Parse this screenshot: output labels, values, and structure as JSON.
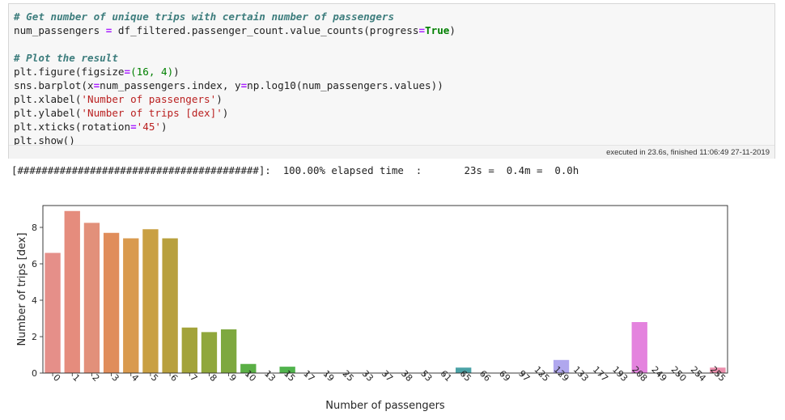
{
  "code_cell": {
    "lines": [
      [
        {
          "t": "# Get number of unique trips with certain number of passengers",
          "c": "cm"
        }
      ],
      [
        {
          "t": "num_passengers "
        },
        {
          "t": "=",
          "c": "op"
        },
        {
          "t": " df_filtered.passenger_count.value_counts(progress"
        },
        {
          "t": "=",
          "c": "op"
        },
        {
          "t": "True",
          "c": "kw"
        },
        {
          "t": ")"
        }
      ],
      [
        {
          "t": ""
        }
      ],
      [
        {
          "t": "# Plot the result",
          "c": "cm"
        }
      ],
      [
        {
          "t": "plt.figure(figsize"
        },
        {
          "t": "=",
          "c": "op"
        },
        {
          "t": "(16, 4)",
          "c": "num"
        },
        {
          "t": ")"
        }
      ],
      [
        {
          "t": "sns.barplot(x"
        },
        {
          "t": "=",
          "c": "op"
        },
        {
          "t": "num_passengers.index, y"
        },
        {
          "t": "=",
          "c": "op"
        },
        {
          "t": "np.log10(num_passengers.values))"
        }
      ],
      [
        {
          "t": "plt.xlabel("
        },
        {
          "t": "'Number of passengers'",
          "c": "str"
        },
        {
          "t": ")"
        }
      ],
      [
        {
          "t": "plt.ylabel("
        },
        {
          "t": "'Number of trips [dex]'",
          "c": "str"
        },
        {
          "t": ")"
        }
      ],
      [
        {
          "t": "plt.xticks(rotation"
        },
        {
          "t": "=",
          "c": "op"
        },
        {
          "t": "'45'",
          "c": "str"
        },
        {
          "t": ")"
        }
      ],
      [
        {
          "t": "plt.show()"
        }
      ]
    ],
    "execution_info": "executed in 23.6s, finished 11:06:49 27-11-2019"
  },
  "progress_output": "[########################################]:  100.00% elapsed time  :       23s =  0.4m =  0.0h",
  "colors": {
    "cell_bg": "#f7f7f7",
    "comment": "#3d7d7d",
    "operator": "#aa22ff",
    "keyword": "#008000",
    "string": "#ba2121"
  },
  "chart_data": {
    "type": "bar",
    "title": "",
    "xlabel": "Number of passengers",
    "ylabel": "Number of trips [dex]",
    "ylim": [
      0,
      9.2
    ],
    "yticks": [
      0,
      2,
      4,
      6,
      8
    ],
    "grid": false,
    "legend": "none",
    "categories": [
      "0",
      "1",
      "2",
      "3",
      "4",
      "5",
      "6",
      "7",
      "8",
      "9",
      "10",
      "13",
      "15",
      "17",
      "19",
      "25",
      "33",
      "37",
      "38",
      "53",
      "61",
      "65",
      "66",
      "69",
      "97",
      "125",
      "129",
      "133",
      "177",
      "193",
      "208",
      "249",
      "250",
      "254",
      "255"
    ],
    "values": [
      6.6,
      8.9,
      8.25,
      7.7,
      7.4,
      7.9,
      7.4,
      2.5,
      2.25,
      2.4,
      0.5,
      0.0,
      0.35,
      0.0,
      0.0,
      0.0,
      0.0,
      0.0,
      0.0,
      0.0,
      0.0,
      0.3,
      0.0,
      0.0,
      0.0,
      0.0,
      0.72,
      0.0,
      0.0,
      0.0,
      2.8,
      0.0,
      0.0,
      0.0,
      0.3
    ],
    "bar_colors": [
      "#e58f89",
      "#e58c7d",
      "#e2907a",
      "#e08d5b",
      "#d99a4e",
      "#c9a043",
      "#b8a03e",
      "#a3a33a",
      "#90a73c",
      "#7ea83f",
      "#5aaf45",
      "#4cb157",
      "#50b34c",
      "#42b36a",
      "#44b58a",
      "#45b596",
      "#46b4a3",
      "#47b3ae",
      "#48b2b7",
      "#49b0bf",
      "#4aaec7",
      "#4aa2a6",
      "#58a6d8",
      "#6aa3e2",
      "#7b9ee8",
      "#8b98ec",
      "#b0a7ee",
      "#b48df0",
      "#c287ee",
      "#d27ee8",
      "#e483de",
      "#e585d0",
      "#e889c4",
      "#ea8bb8",
      "#ec8fad"
    ]
  }
}
